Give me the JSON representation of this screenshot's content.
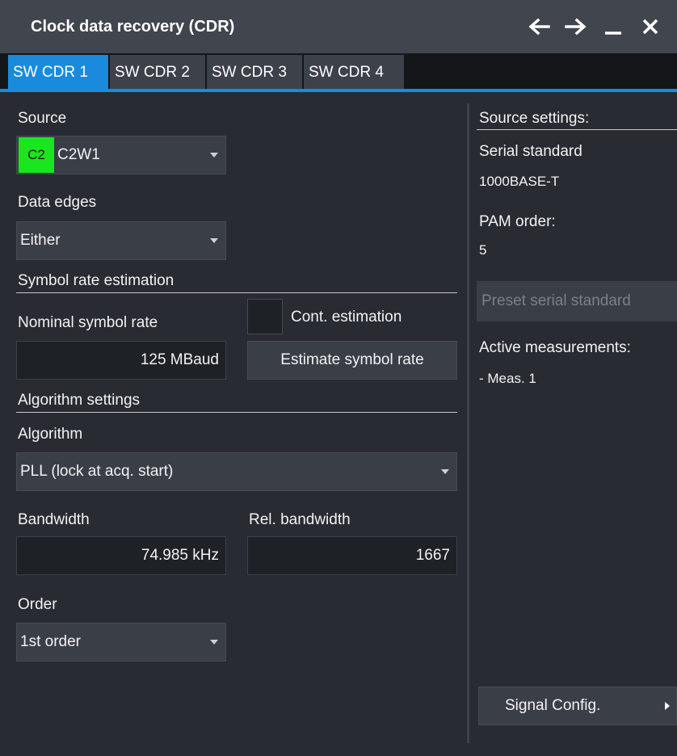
{
  "window": {
    "title": "Clock data recovery (CDR)",
    "icons": [
      "arrow-left-icon",
      "arrow-right-icon",
      "minimize-icon",
      "close-icon"
    ]
  },
  "tabs": [
    {
      "label": "SW CDR 1",
      "active": true
    },
    {
      "label": "SW CDR 2",
      "active": false
    },
    {
      "label": "SW CDR 3",
      "active": false
    },
    {
      "label": "SW CDR 4",
      "active": false
    }
  ],
  "left": {
    "source": {
      "label": "Source",
      "badge": "C2",
      "badge_color": "#19e61e",
      "value": "C2W1"
    },
    "data_edges": {
      "label": "Data edges",
      "value": "Either"
    },
    "symbol_rate_section": "Symbol rate estimation",
    "nominal_symbol_rate": {
      "label": "Nominal symbol rate",
      "value": "125 MBaud"
    },
    "cont_estimation": {
      "label": "Cont. estimation",
      "checked": false
    },
    "estimate_button": "Estimate symbol rate",
    "algorithm_section": "Algorithm settings",
    "algorithm": {
      "label": "Algorithm",
      "value": "PLL (lock at acq. start)"
    },
    "bandwidth": {
      "label": "Bandwidth",
      "value": "74.985 kHz"
    },
    "rel_bandwidth": {
      "label": "Rel. bandwidth",
      "value": "1667"
    },
    "order": {
      "label": "Order",
      "value": "1st order"
    }
  },
  "right": {
    "source_settings_heading": "Source settings:",
    "serial_standard_label": "Serial standard",
    "serial_standard_value": "1000BASE-T",
    "pam_order_label": "PAM order:",
    "pam_order_value": "5",
    "preset_button": "Preset serial standard",
    "active_measurements_label": "Active measurements:",
    "active_measurements": [
      "- Meas. 1"
    ],
    "signal_config_button": "Signal Config."
  },
  "colors": {
    "accent": "#1a8bdc",
    "titlebar": "#40454e",
    "panel": "#282b32",
    "source_badge": "#19e61e"
  }
}
